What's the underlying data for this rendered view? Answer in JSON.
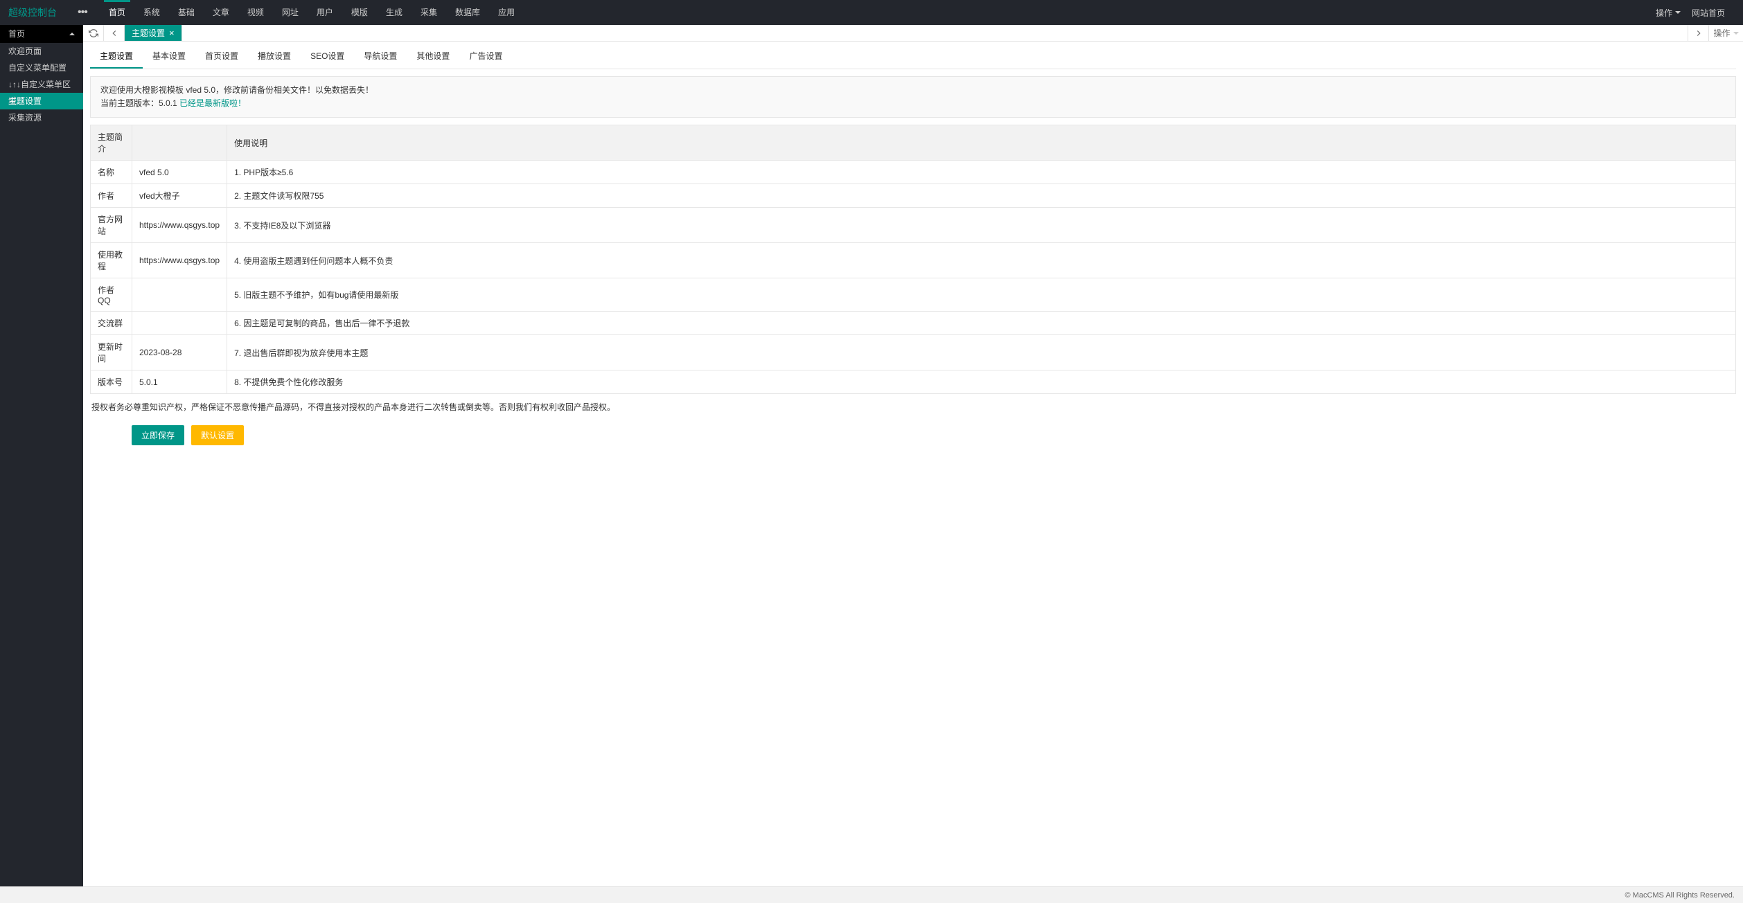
{
  "header": {
    "logo": "超级控制台",
    "nav": [
      "首页",
      "系统",
      "基础",
      "文章",
      "视频",
      "网址",
      "用户",
      "模版",
      "生成",
      "采集",
      "数据库",
      "应用"
    ],
    "nav_active": 0,
    "action": "操作",
    "site_link": "网站首页"
  },
  "sidebar": {
    "group": "首页",
    "items": [
      "欢迎页面",
      "自定义菜单配置",
      "↓↑↓自定义菜单区域↓↑↓",
      "主题设置",
      "采集资源"
    ],
    "active_index": 3
  },
  "tabbar": {
    "tab": "主题设置",
    "action": "操作"
  },
  "subtabs": {
    "items": [
      "主题设置",
      "基本设置",
      "首页设置",
      "播放设置",
      "SEO设置",
      "导航设置",
      "其他设置",
      "广告设置"
    ],
    "active_index": 0
  },
  "notice": {
    "line1": "欢迎使用大橙影视模板 vfed 5.0，修改前请备份相关文件！以免数据丢失！",
    "line2_prefix": "当前主题版本：5.0.1  ",
    "line2_green": "已经是最新版啦！"
  },
  "table": {
    "header_left": "主题简介",
    "header_right": "使用说明",
    "rows": [
      {
        "label": "名称",
        "value": "vfed 5.0",
        "note": "1. PHP版本≥5.6"
      },
      {
        "label": "作者",
        "value": "vfed大橙子",
        "note": "2. 主题文件读写权限755"
      },
      {
        "label": "官方网站",
        "value": "https://www.qsgys.top",
        "note": "3. 不支持IE8及以下浏览器"
      },
      {
        "label": "使用教程",
        "value": "https://www.qsgys.top",
        "note": "4. 使用盗版主题遇到任何问题本人概不负责"
      },
      {
        "label": "作者QQ",
        "value": "",
        "note": "5. 旧版主题不予维护，如有bug请使用最新版"
      },
      {
        "label": "交流群",
        "value": "",
        "note": "6. 因主题是可复制的商品，售出后一律不予退款"
      },
      {
        "label": "更新时间",
        "value": "2023-08-28",
        "note": "7. 退出售后群即视为放弃使用本主题"
      },
      {
        "label": "版本号",
        "value": "5.0.1",
        "note": "8. 不提供免费个性化修改服务"
      }
    ]
  },
  "notice_text": "授权者务必尊重知识产权，严格保证不恶意传播产品源码，不得直接对授权的产品本身进行二次转售或倒卖等。否则我们有权利收回产品授权。",
  "buttons": {
    "save": "立即保存",
    "default": "默认设置"
  },
  "footer": "© MacCMS All Rights Reserved."
}
